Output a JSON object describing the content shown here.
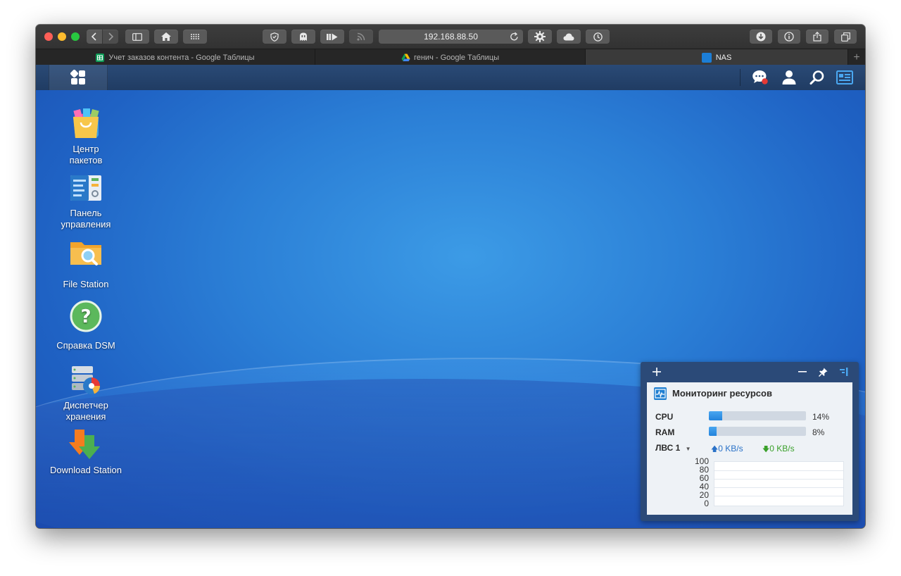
{
  "browser": {
    "url": "192.168.88.50",
    "tabs": [
      {
        "label": "Учет заказов контента - Google Таблицы",
        "active": false
      },
      {
        "label": "генич - Google Таблицы",
        "active": false
      },
      {
        "label": "NAS",
        "active": true
      }
    ]
  },
  "desktop": {
    "icons": [
      {
        "label": "Центр пакетов",
        "icon": "package-center-icon"
      },
      {
        "label": "Панель управления",
        "icon": "control-panel-icon"
      },
      {
        "label": "File Station",
        "icon": "file-station-icon"
      },
      {
        "label": "Справка DSM",
        "icon": "help-icon"
      },
      {
        "label": "Диспетчер хранения",
        "icon": "storage-manager-icon"
      },
      {
        "label": "Download Station",
        "icon": "download-station-icon"
      }
    ]
  },
  "widget": {
    "title": "Мониторинг ресурсов",
    "cpu": {
      "label": "CPU",
      "value": "14%",
      "fraction": 0.14
    },
    "ram": {
      "label": "RAM",
      "value": "8%",
      "fraction": 0.08
    },
    "network": {
      "label": "ЛВС 1",
      "upload": "0 KB/s",
      "download": "0 KB/s"
    },
    "chart_ticks": [
      "100",
      "80",
      "60",
      "40",
      "20",
      "0"
    ]
  },
  "colors": {
    "accent": "#2283dc",
    "upload": "#2a72c8",
    "download": "#3aa02a",
    "taskbar": "#233f66"
  }
}
